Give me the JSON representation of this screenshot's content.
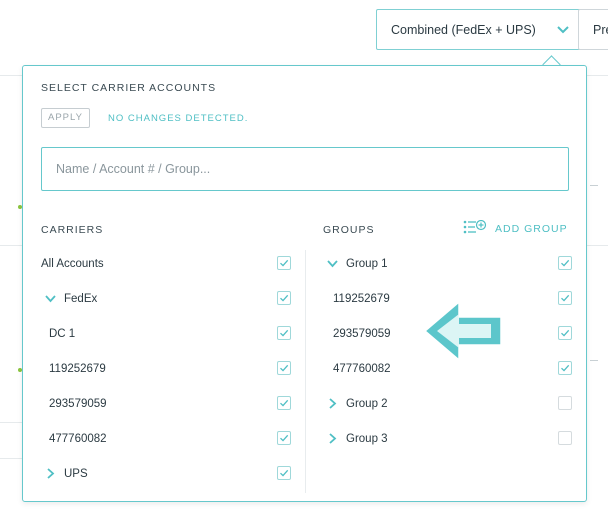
{
  "header": {
    "carrier_select_value": "Combined (FedEx + UPS)",
    "next_button_label": "Pre"
  },
  "panel": {
    "title": "SELECT CARRIER ACCOUNTS",
    "apply_label": "APPLY",
    "status_text": "NO CHANGES DETECTED.",
    "search_placeholder": "Name / Account # / Group..."
  },
  "carriers": {
    "header": "CARRIERS",
    "rows": [
      {
        "label": "All Accounts",
        "level": 0,
        "expander": "none",
        "checked": true
      },
      {
        "label": "FedEx",
        "level": 1,
        "expander": "expanded",
        "checked": true
      },
      {
        "label": "DC 1",
        "level": 2,
        "expander": "none",
        "checked": true
      },
      {
        "label": "119252679",
        "level": 2,
        "expander": "none",
        "checked": true
      },
      {
        "label": "293579059",
        "level": 2,
        "expander": "none",
        "checked": true
      },
      {
        "label": "477760082",
        "level": 2,
        "expander": "none",
        "checked": true
      },
      {
        "label": "UPS",
        "level": 1,
        "expander": "collapsed",
        "checked": true
      }
    ]
  },
  "groups": {
    "header": "GROUPS",
    "add_label": "ADD GROUP",
    "rows": [
      {
        "label": "Group 1",
        "expander": "expanded",
        "checked": true
      },
      {
        "label": "119252679",
        "expander": "none",
        "checked": true
      },
      {
        "label": "293579059",
        "expander": "none",
        "checked": true
      },
      {
        "label": "477760082",
        "expander": "none",
        "checked": true
      },
      {
        "label": "Group 2",
        "expander": "collapsed",
        "checked": false
      },
      {
        "label": "Group 3",
        "expander": "collapsed",
        "checked": false
      }
    ]
  },
  "colors": {
    "accent": "#4fbfc4",
    "border_accent": "#66c8cc",
    "arrow_fill": "#5cc6cb"
  },
  "icons": {
    "select_chevron": "chevron-down-icon",
    "add_group": "add-list-icon",
    "expanded": "chevron-down-icon",
    "collapsed": "chevron-right-icon",
    "checked": "check-icon",
    "callout": "arrow-left-icon"
  }
}
